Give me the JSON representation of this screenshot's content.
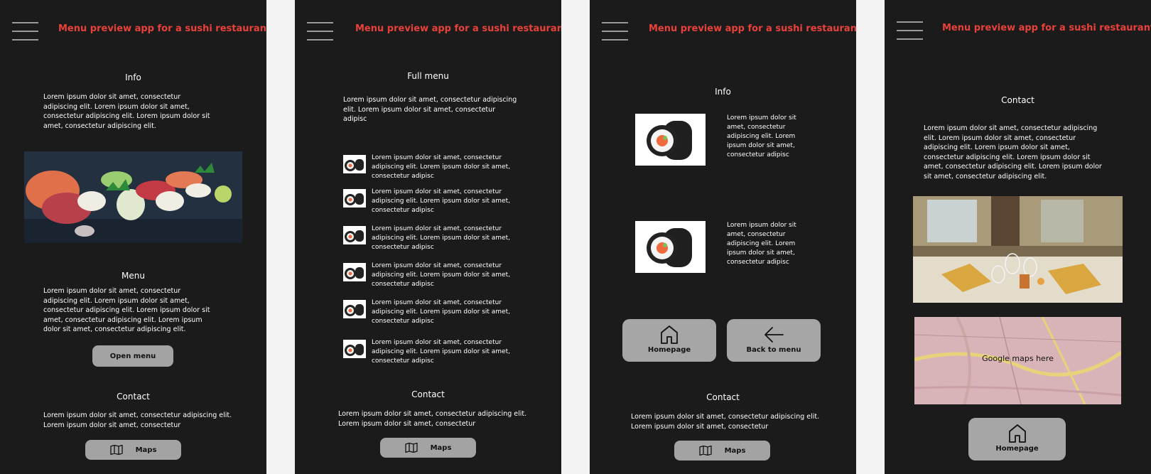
{
  "app_title": "Menu preview app for a sushi restaurant",
  "screen1": {
    "info_heading": "Info",
    "info_text": "Lorem ipsum dolor sit amet, consectetur adipiscing elit. Lorem ipsum dolor sit amet, consectetur adipiscing elit. Lorem ipsum dolor sit amet, consectetur adipiscing elit.",
    "menu_heading": "Menu",
    "menu_text": "Lorem ipsum dolor sit amet, consectetur adipiscing elit. Lorem ipsum dolor sit amet, consectetur adipiscing elit. Lorem ipsum dolor sit amet, consectetur adipiscing elit. Lorem ipsum dolor sit amet, consectetur adipiscing elit.",
    "open_menu_label": "Open menu",
    "contact_heading": "Contact",
    "contact_text": "Lorem ipsum dolor sit amet, consectetur adipiscing elit. Lorem ipsum dolor sit amet, consectetur",
    "maps_label": "Maps"
  },
  "screen2": {
    "full_menu_heading": "Full menu",
    "intro_text": "Lorem ipsum dolor sit amet, consectetur adipiscing elit. Lorem ipsum dolor sit amet, consectetur adipisc",
    "items": [
      "Lorem ipsum dolor sit amet, consectetur adipiscing elit. Lorem ipsum dolor sit amet, consectetur adipisc",
      "Lorem ipsum dolor sit amet, consectetur adipiscing elit. Lorem ipsum dolor sit amet, consectetur adipisc",
      "Lorem ipsum dolor sit amet, consectetur adipiscing elit. Lorem ipsum dolor sit amet, consectetur adipisc",
      "Lorem ipsum dolor sit amet, consectetur adipiscing elit. Lorem ipsum dolor sit amet, consectetur adipisc",
      "Lorem ipsum dolor sit amet, consectetur adipiscing elit. Lorem ipsum dolor sit amet, consectetur adipisc",
      "Lorem ipsum dolor sit amet, consectetur adipiscing elit. Lorem ipsum dolor sit amet, consectetur adipisc"
    ],
    "contact_heading": "Contact",
    "contact_text": "Lorem ipsum dolor sit amet, consectetur adipiscing elit. Lorem ipsum dolor sit amet, consectetur",
    "maps_label": "Maps"
  },
  "screen3": {
    "info_heading": "Info",
    "item1_text": "Lorem ipsum dolor sit amet, consectetur adipiscing elit. Lorem ipsum dolor sit amet, consectetur adipisc",
    "item2_text": "Lorem ipsum dolor sit amet, consectetur adipiscing elit. Lorem ipsum dolor sit amet, consectetur adipisc",
    "homepage_label": "Homepage",
    "back_label": "Back to menu",
    "contact_heading": "Contact",
    "contact_text": "Lorem ipsum dolor sit amet, consectetur adipiscing elit. Lorem ipsum dolor sit amet, consectetur",
    "maps_label": "Maps"
  },
  "screen4": {
    "contact_heading": "Contact",
    "contact_text": "Lorem ipsum dolor sit amet, consectetur adipiscing elit. Lorem ipsum dolor sit amet, consectetur adipiscing elit. Lorem ipsum dolor sit amet, consectetur adipiscing elit. Lorem ipsum dolor sit amet, consectetur adipiscing elit. Lorem ipsum dolor sit amet, consectetur adipiscing elit.",
    "map_text": "Google maps here",
    "homepage_label": "Homepage"
  },
  "icons": {
    "menu": "hamburger-icon",
    "map": "map-icon",
    "home": "home-icon",
    "back": "arrow-left-icon"
  },
  "colors": {
    "screen_bg": "#1b1b1b",
    "page_bg": "#f3f3f3",
    "title_accent": "#e8413a",
    "button_bg": "#a3a3a3"
  }
}
